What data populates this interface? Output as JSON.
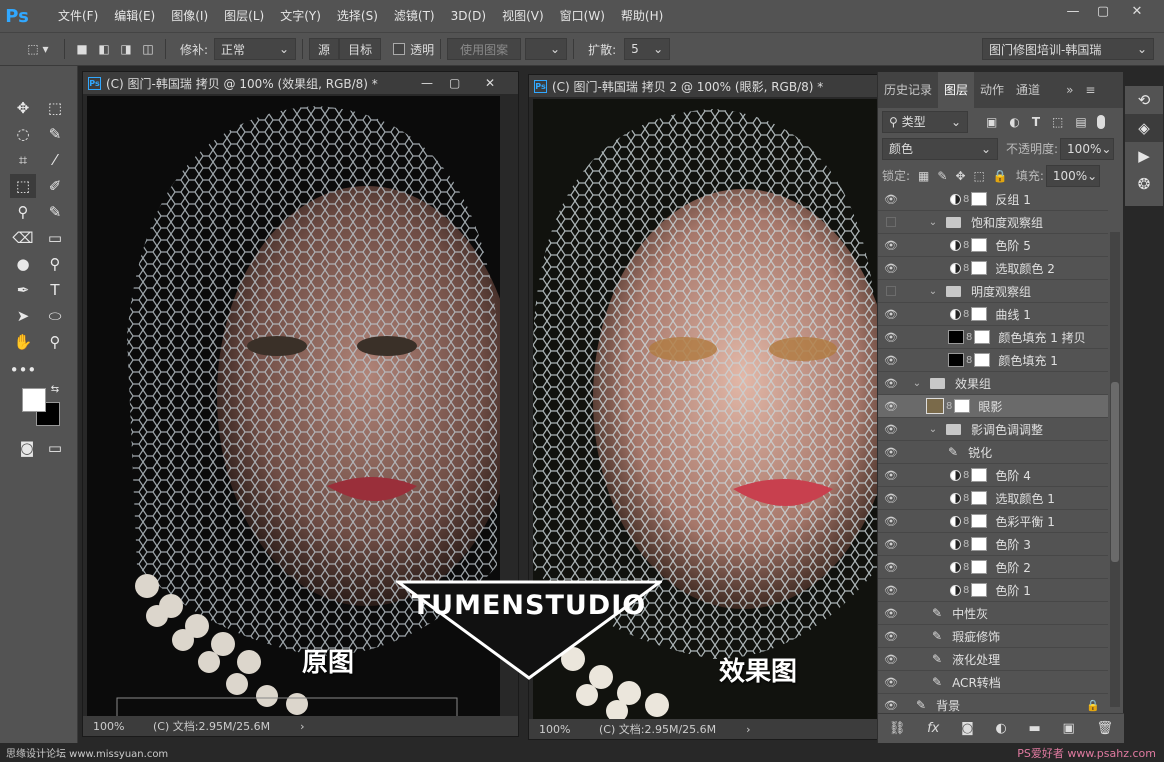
{
  "app": {
    "logo": "Ps"
  },
  "menu": [
    "文件(F)",
    "编辑(E)",
    "图像(I)",
    "图层(L)",
    "文字(Y)",
    "选择(S)",
    "滤镜(T)",
    "3D(D)",
    "视图(V)",
    "窗口(W)",
    "帮助(H)"
  ],
  "options": {
    "patch_label": "修补:",
    "patch_mode": "正常",
    "source_btn": "源",
    "target_btn": "目标",
    "transparent_label": "透明",
    "use_pattern_btn": "使用图案",
    "spread_label": "扩散:",
    "spread_value": "5",
    "workspace": "图门修图培训-韩国瑞"
  },
  "doc1": {
    "title": "(C) 图门-韩国瑞 拷贝 @ 100% (效果组, RGB/8) *",
    "zoom": "100%",
    "status": "(C) 文档:2.95M/25.6M",
    "caption": "原图"
  },
  "doc2": {
    "title": "(C) 图门-韩国瑞 拷贝 2 @ 100% (眼影, RGB/8) *",
    "zoom": "100%",
    "status": "(C) 文档:2.95M/25.6M",
    "caption": "效果图"
  },
  "watermark": "TUMENSTUDIO",
  "panel": {
    "tabs": [
      "历史记录",
      "图层",
      "动作",
      "通道"
    ],
    "filter_label": "类型",
    "blend_mode": "颜色",
    "opacity_label": "不透明度:",
    "opacity_value": "100%",
    "lock_label": "锁定:",
    "fill_label": "填充:",
    "fill_value": "100%",
    "layers": [
      {
        "name": "反组 1",
        "kind": "adj",
        "indent": 2,
        "visible": true
      },
      {
        "name": "饱和度观察组",
        "kind": "group",
        "indent": 1,
        "visible": false
      },
      {
        "name": "色阶 5",
        "kind": "adj",
        "indent": 2,
        "visible": true
      },
      {
        "name": "选取颜色 2",
        "kind": "adj",
        "indent": 2,
        "visible": true
      },
      {
        "name": "明度观察组",
        "kind": "group",
        "indent": 1,
        "visible": false
      },
      {
        "name": "曲线 1",
        "kind": "adj",
        "indent": 2,
        "visible": true
      },
      {
        "name": "颜色填充 1 拷贝",
        "kind": "fill",
        "indent": 2,
        "visible": true
      },
      {
        "name": "颜色填充 1",
        "kind": "fill",
        "indent": 2,
        "visible": true
      },
      {
        "name": "效果组",
        "kind": "group",
        "indent": 0,
        "visible": true
      },
      {
        "name": "眼影",
        "kind": "swatch",
        "indent": 1,
        "visible": true,
        "selected": true
      },
      {
        "name": "影调色调调整",
        "kind": "group",
        "indent": 1,
        "visible": true
      },
      {
        "name": "锐化",
        "kind": "brush",
        "indent": 2,
        "visible": true
      },
      {
        "name": "色阶 4",
        "kind": "adj",
        "indent": 2,
        "visible": true
      },
      {
        "name": "选取颜色 1",
        "kind": "adj",
        "indent": 2,
        "visible": true
      },
      {
        "name": "色彩平衡 1",
        "kind": "adj",
        "indent": 2,
        "visible": true
      },
      {
        "name": "色阶 3",
        "kind": "adj",
        "indent": 2,
        "visible": true
      },
      {
        "name": "色阶 2",
        "kind": "adj",
        "indent": 2,
        "visible": true
      },
      {
        "name": "色阶 1",
        "kind": "adj",
        "indent": 2,
        "visible": true
      },
      {
        "name": "中性灰",
        "kind": "brush",
        "indent": 1,
        "visible": true
      },
      {
        "name": "瑕疵修饰",
        "kind": "brush",
        "indent": 1,
        "visible": true
      },
      {
        "name": "液化处理",
        "kind": "brush",
        "indent": 1,
        "visible": true
      },
      {
        "name": "ACR转档",
        "kind": "brush",
        "indent": 1,
        "visible": true
      },
      {
        "name": "背景",
        "kind": "brush",
        "indent": 0,
        "visible": true
      }
    ]
  },
  "footer": {
    "left": "思缘设计论坛 www.missyuan.com",
    "right": "PS爱好者 www.psahz.com"
  },
  "colors": {
    "eyeshadow_swatch": "#7a6a4a",
    "ps_blue": "#31a8ff"
  }
}
